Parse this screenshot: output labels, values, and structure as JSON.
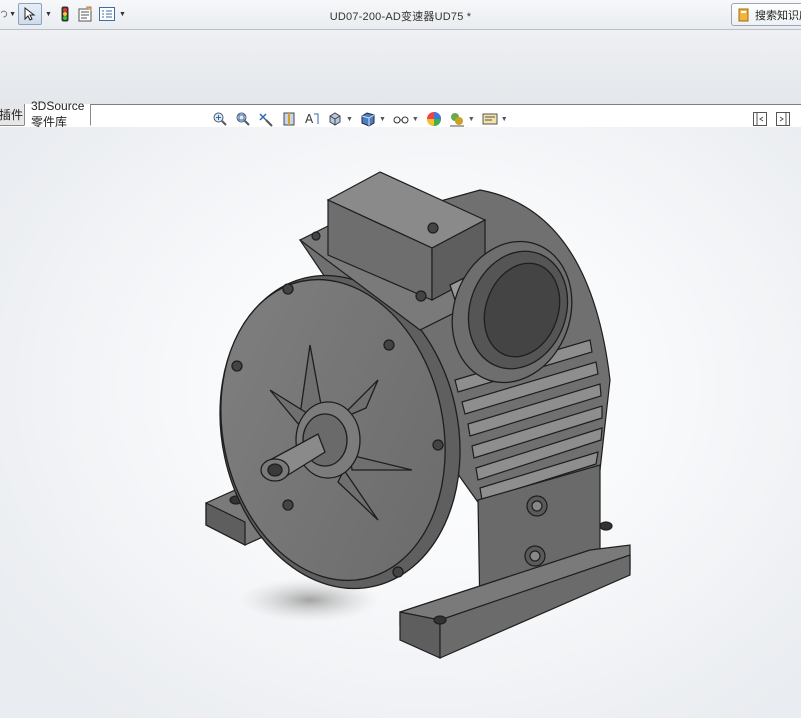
{
  "window": {
    "title": "UD07-200-AD变速器UD75 *",
    "search_label": "搜索知识库"
  },
  "tabs": [
    {
      "label": "插件"
    },
    {
      "label": "3DSource零件库"
    }
  ],
  "qa_toolbar": [
    "undo-icon",
    "select-arrow-icon",
    "traffic-light-icon",
    "file-properties-icon",
    "options-list-icon"
  ],
  "view_toolbar": [
    "zoom-to-fit-icon",
    "zoom-to-area-icon",
    "previous-view-icon",
    "section-view-icon",
    "dynamic-annotation-icon",
    "view-orientation-icon",
    "display-style-icon",
    "hide-show-items-icon",
    "edit-appearance-icon",
    "apply-scene-icon",
    "view-settings-icon"
  ],
  "colors": {
    "model_gray": "#6e6e6e",
    "model_dark": "#3c3c3c",
    "model_light": "#8a8a8a"
  }
}
